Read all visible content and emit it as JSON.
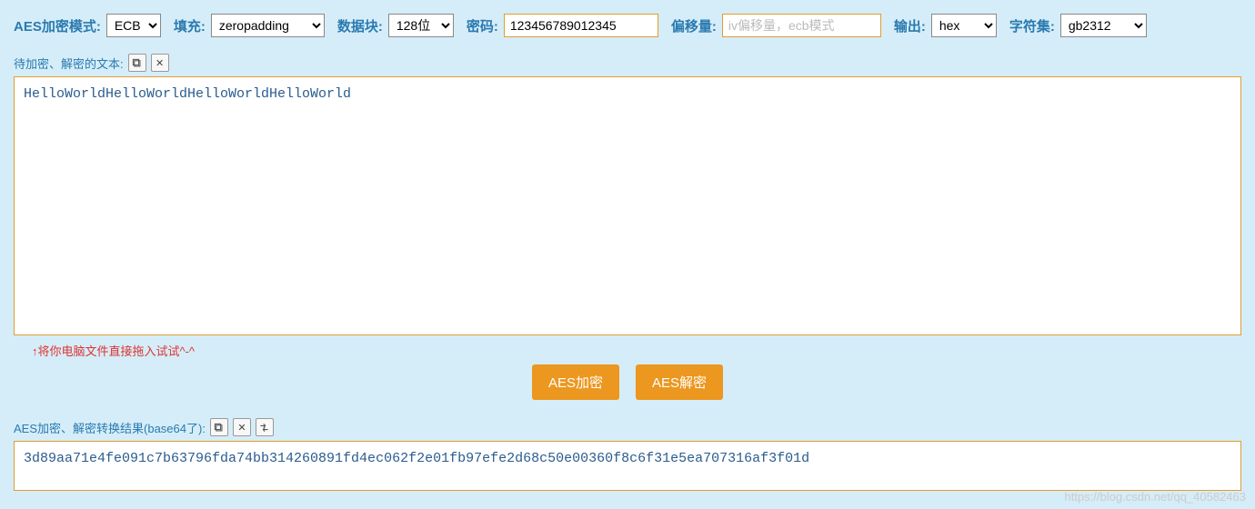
{
  "toolbar": {
    "mode_label": "AES加密模式:",
    "mode_value": "ECB",
    "padding_label": "填充:",
    "padding_value": "zeropadding",
    "block_label": "数据块:",
    "block_value": "128位",
    "password_label": "密码:",
    "password_value": "123456789012345",
    "iv_label": "偏移量:",
    "iv_placeholder": "iv偏移量，ecb模式",
    "output_label": "输出:",
    "output_value": "hex",
    "charset_label": "字符集:",
    "charset_value": "gb2312"
  },
  "input": {
    "section_label": "待加密、解密的文本:",
    "text": "HelloWorldHelloWorldHelloWorldHelloWorld",
    "hint": "↑将你电脑文件直接拖入试试^-^"
  },
  "buttons": {
    "encrypt": "AES加密",
    "decrypt": "AES解密"
  },
  "output": {
    "section_label": "AES加密、解密转换结果(base64了):",
    "text": "3d89aa71e4fe091c7b63796fda74bb314260891fd4ec062f2e01fb97efe2d68c50e00360f8c6f31e5ea707316af3f01d"
  },
  "watermark": "https://blog.csdn.net/qq_40582463"
}
